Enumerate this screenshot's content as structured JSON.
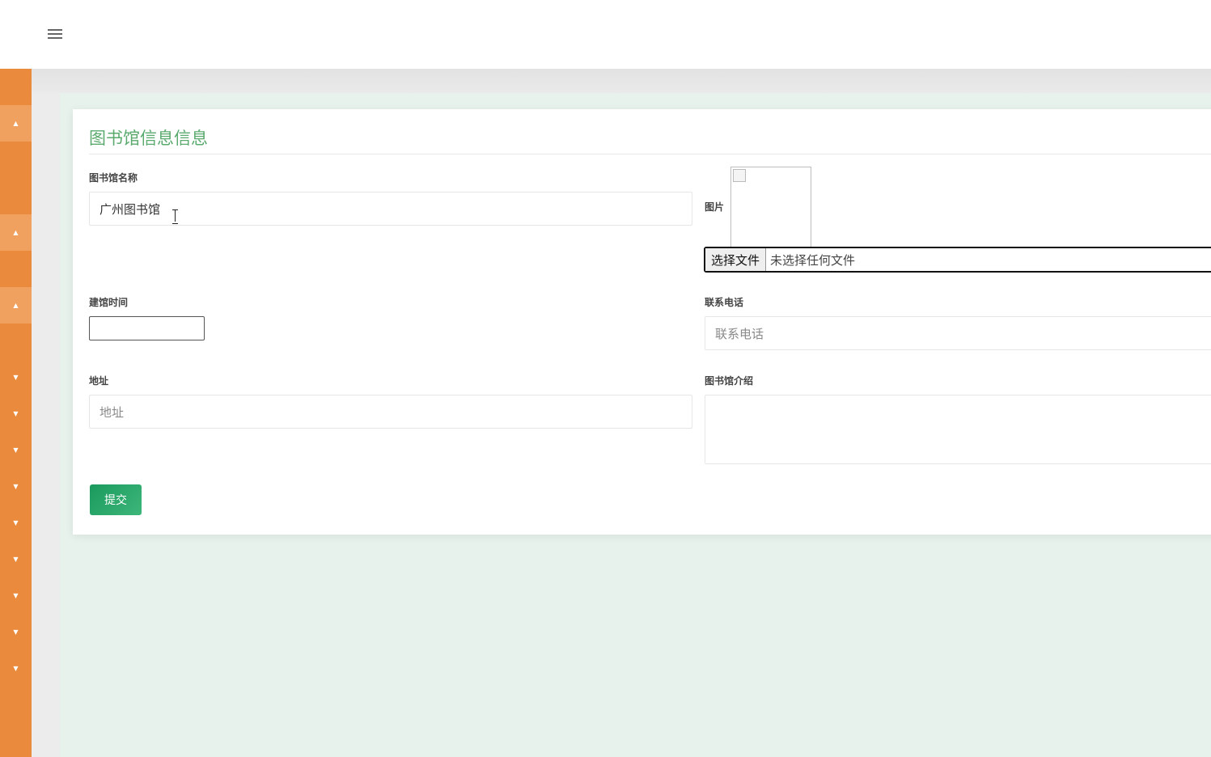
{
  "header": {
    "menu_icon": "hamburger-menu-icon"
  },
  "sidebar": {
    "items": [
      {
        "icon": "caret-up-icon",
        "glyph": "▲",
        "active": true
      },
      {
        "icon": "caret-up-icon",
        "glyph": "▲",
        "active": true
      },
      {
        "icon": "caret-up-icon",
        "glyph": "▲",
        "active": true
      },
      {
        "icon": "caret-down-icon",
        "glyph": "▼",
        "active": false
      },
      {
        "icon": "caret-down-icon",
        "glyph": "▼",
        "active": false
      },
      {
        "icon": "caret-down-icon",
        "glyph": "▼",
        "active": false
      },
      {
        "icon": "caret-down-icon",
        "glyph": "▼",
        "active": false
      },
      {
        "icon": "caret-down-icon",
        "glyph": "▼",
        "active": false
      },
      {
        "icon": "caret-down-icon",
        "glyph": "▼",
        "active": false
      },
      {
        "icon": "caret-down-icon",
        "glyph": "▼",
        "active": false
      },
      {
        "icon": "caret-down-icon",
        "glyph": "▼",
        "active": false
      },
      {
        "icon": "caret-down-icon",
        "glyph": "▼",
        "active": false
      }
    ]
  },
  "form": {
    "title": "图书馆信息信息",
    "name": {
      "label": "图书馆名称",
      "value": "广州图书馆"
    },
    "image": {
      "label": "图片",
      "choose_button": "选择文件",
      "status": "未选择任何文件"
    },
    "founded": {
      "label": "建馆时间",
      "value": ""
    },
    "phone": {
      "label": "联系电话",
      "placeholder": "联系电话"
    },
    "address": {
      "label": "地址",
      "placeholder": "地址"
    },
    "intro": {
      "label": "图书馆介绍",
      "value": ""
    },
    "submit_label": "提交"
  },
  "colors": {
    "sidebar": "#ea8a3d",
    "accent_green": "#5aaa6e",
    "submit": "#1a9a5d",
    "content_bg": "#e8f2ec"
  }
}
